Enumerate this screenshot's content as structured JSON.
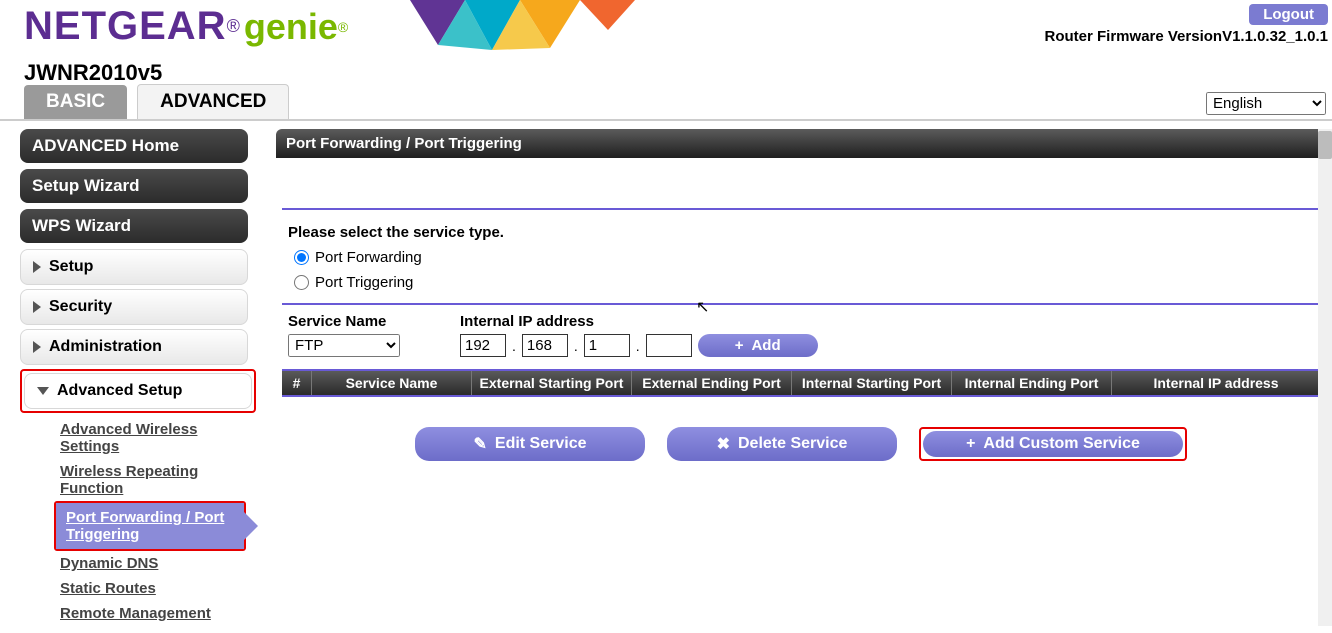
{
  "header": {
    "brand": "NETGEAR",
    "sub_brand": "genie",
    "model": "JWNR2010v5",
    "logout": "Logout",
    "firmware": "Router Firmware VersionV1.1.0.32_1.0.1"
  },
  "tabs": {
    "basic": "BASIC",
    "advanced": "ADVANCED",
    "language": "English"
  },
  "sidebar": {
    "pills": [
      "ADVANCED Home",
      "Setup Wizard",
      "WPS Wizard"
    ],
    "menu": [
      "Setup",
      "Security",
      "Administration"
    ],
    "adv_setup": "Advanced Setup",
    "sub": {
      "aws": "Advanced Wireless Settings",
      "wrf": "Wireless Repeating Function",
      "pf": "Port Forwarding / Port Triggering",
      "ddns": "Dynamic DNS",
      "sr": "Static Routes",
      "rm": "Remote Management"
    }
  },
  "panel": {
    "title": "Port Forwarding / Port Triggering",
    "select_prompt": "Please select the service type.",
    "radio_fwd": "Port Forwarding",
    "radio_trig": "Port Triggering",
    "svc_label": "Service Name",
    "svc_value": "FTP",
    "ip_label": "Internal IP address",
    "ip": [
      "192",
      "168",
      "1",
      ""
    ],
    "add": "Add",
    "cols": [
      "#",
      "Service Name",
      "External Starting Port",
      "External Ending Port",
      "Internal Starting Port",
      "Internal Ending Port",
      "Internal IP address"
    ],
    "btn_edit": "Edit Service",
    "btn_del": "Delete Service",
    "btn_addcustom": "Add Custom Service"
  }
}
